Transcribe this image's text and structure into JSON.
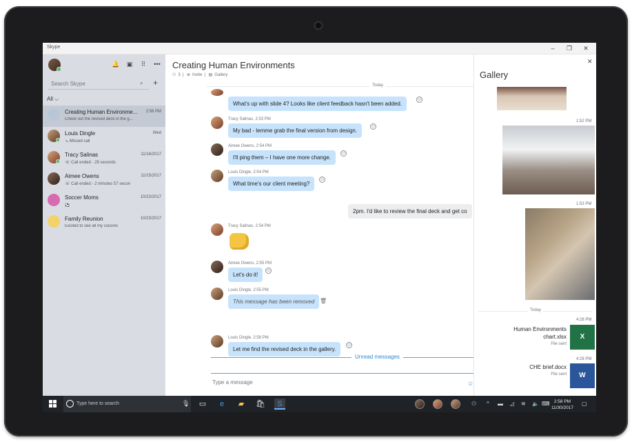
{
  "window": {
    "app_title": "Skype",
    "controls": {
      "minimize": "–",
      "maximize": "❐",
      "close": "✕"
    }
  },
  "sidebar": {
    "search_placeholder": "Search Skype",
    "add_label": "+",
    "filter_label": "All ⌵",
    "contacts": [
      {
        "name": "Creating Human Environme...",
        "sub": "Check out the revised deck in the g...",
        "time": "2:58 PM",
        "selected": true
      },
      {
        "name": "Louis Dingle",
        "sub": "↘ Missed call",
        "time": "Wed"
      },
      {
        "name": "Tracy Salinas",
        "sub": "☏ Call ended - 29 seconds",
        "time": "11/16/2017"
      },
      {
        "name": "Aimee Owens",
        "sub": "☏ Call ended - 2 minutes 57 secon",
        "time": "11/15/2017"
      },
      {
        "name": "Soccer Moms",
        "sub": "⚽",
        "time": "10/23/2017"
      },
      {
        "name": "Family Reunion",
        "sub": "Excited to see all my cousins",
        "time": "10/23/2017"
      }
    ]
  },
  "chat": {
    "title": "Creating Human Environments",
    "meta": {
      "participants": "3",
      "invite": "Invite",
      "gallery": "Gallery"
    },
    "day_label": "Today",
    "messages": [
      {
        "sender": "",
        "text": "What's up with slide 4? Looks like client feedback hasn't been added."
      },
      {
        "sender": "Tracy Salinas, 2:53 PM",
        "text": "My bad - lemme grab the final version from design."
      },
      {
        "sender": "Aimee Owens, 2:54 PM",
        "text": "I'll ping them – I have one more change."
      },
      {
        "sender": "Louis Dingle, 2:54 PM",
        "text": "What time's our client meeting?"
      },
      {
        "sender": "",
        "text": "2pm. I'd like to review the final deck and get co"
      },
      {
        "sender": "Tracy Salinas, 2:54 PM",
        "text": ""
      },
      {
        "sender": "Aimee Owens, 2:55 PM",
        "text": "Let's do it!"
      },
      {
        "sender": "Louis Dingle, 2:55 PM",
        "text": "This message has been removed"
      },
      {
        "sender": "Louis Dingle, 2:58 PM",
        "text": "Let me find the revised deck in the gallery."
      }
    ],
    "unread_label": "Unread messages",
    "compose_placeholder": "Type a message"
  },
  "gallery": {
    "title": "Gallery",
    "times": [
      "1:52 PM",
      "1:53 PM",
      "4:28 PM",
      "4:28 PM"
    ],
    "today_label": "Today",
    "files": [
      {
        "name_line1": "Human Environments",
        "name_line2": "chart.xlsx",
        "status": "File sent",
        "icon": "X"
      },
      {
        "name_line1": "CHE brief.docx",
        "name_line2": "",
        "status": "File sent",
        "icon": "W"
      }
    ]
  },
  "taskbar": {
    "search_placeholder": "Type here to search",
    "clock_time": "2:58 PM",
    "clock_date": "11/30/2017"
  },
  "colors": {
    "bubble_incoming": "#c7e3fb",
    "sidebar_bg": "#d9dde3",
    "accent": "#2b8ad8",
    "excel_green": "#217346",
    "word_blue": "#2b579a"
  }
}
